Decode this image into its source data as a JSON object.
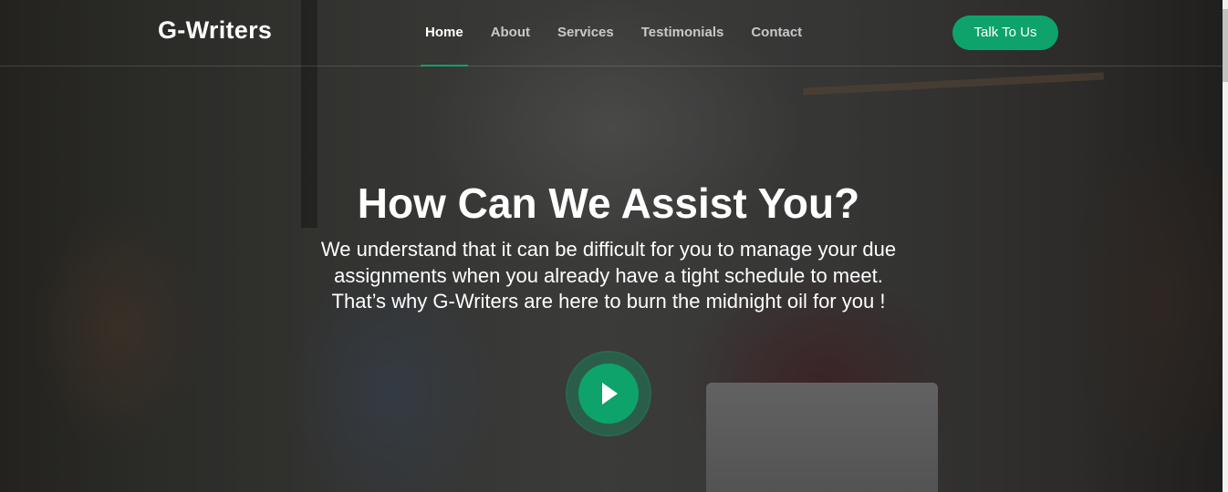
{
  "brand": {
    "name": "G-Writers"
  },
  "nav": {
    "items": [
      {
        "label": "Home",
        "active": true
      },
      {
        "label": "About",
        "active": false
      },
      {
        "label": "Services",
        "active": false
      },
      {
        "label": "Testimonials",
        "active": false
      },
      {
        "label": "Contact",
        "active": false
      }
    ],
    "cta_label": "Talk To Us"
  },
  "hero": {
    "title": "How Can We Assist You?",
    "lines": [
      "We understand that it can be difficult for you to manage your due",
      "assignments when you already have a tight schedule to meet.",
      "That’s why G-Writers are here to burn the midnight oil for you !"
    ],
    "play_icon": "play-icon"
  },
  "colors": {
    "accent": "#0ea36b",
    "text": "#ffffff"
  }
}
